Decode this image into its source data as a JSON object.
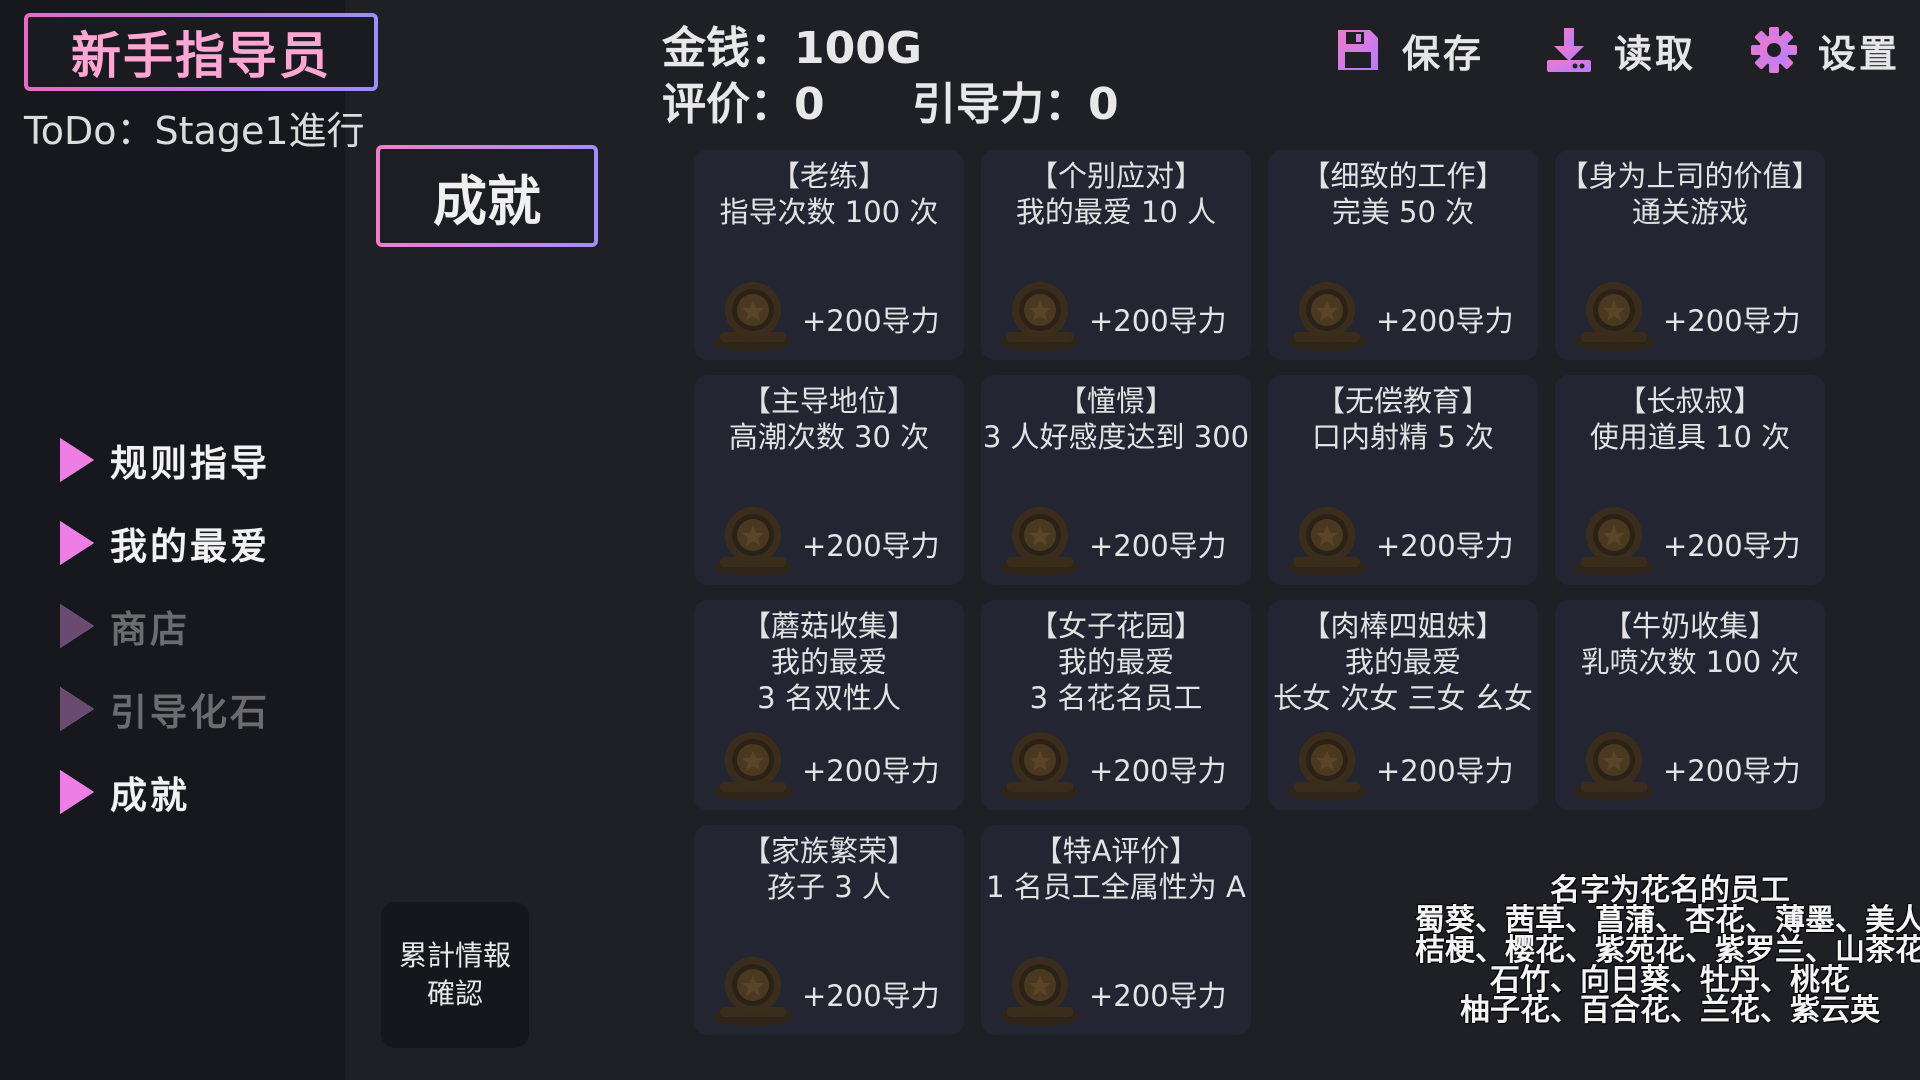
{
  "game_title": "新手指导员",
  "todo": "ToDo：Stage1進行",
  "header": {
    "money": "金钱：100G",
    "rating": "评价：0",
    "guide_power": "引导力：0"
  },
  "toolbar": {
    "save": "保存",
    "load": "读取",
    "settings": "设置"
  },
  "nav": [
    {
      "label": "规则指导",
      "enabled": true
    },
    {
      "label": "我的最爱",
      "enabled": true
    },
    {
      "label": "商店",
      "enabled": false
    },
    {
      "label": "引导化石",
      "enabled": false
    },
    {
      "label": "成就",
      "enabled": true
    }
  ],
  "page_title": "成就",
  "stats_button": {
    "line1": "累計情報",
    "line2": "確認"
  },
  "achievements": [
    {
      "name": "【老练】",
      "lines": [
        "指导次数 100 次"
      ],
      "reward": "+200导力"
    },
    {
      "name": "【个别应对】",
      "lines": [
        "我的最爱 10 人"
      ],
      "reward": "+200导力"
    },
    {
      "name": "【细致的工作】",
      "lines": [
        "完美 50 次"
      ],
      "reward": "+200导力"
    },
    {
      "name": "【身为上司的价值】",
      "lines": [
        "通关游戏"
      ],
      "reward": "+200导力"
    },
    {
      "name": "【主导地位】",
      "lines": [
        "高潮次数 30 次"
      ],
      "reward": "+200导力"
    },
    {
      "name": "【憧憬】",
      "lines": [
        "3 人好感度达到 300"
      ],
      "reward": "+200导力"
    },
    {
      "name": "【无偿教育】",
      "lines": [
        "口内射精 5 次"
      ],
      "reward": "+200导力"
    },
    {
      "name": "【长叔叔】",
      "lines": [
        "使用道具 10 次"
      ],
      "reward": "+200导力"
    },
    {
      "name": "【蘑菇收集】",
      "lines": [
        "我的最爱",
        "3 名双性人"
      ],
      "reward": "+200导力"
    },
    {
      "name": "【女子花园】",
      "lines": [
        "我的最爱",
        "3 名花名员工"
      ],
      "reward": "+200导力"
    },
    {
      "name": "【肉棒四姐妹】",
      "lines": [
        "我的最爱",
        "长女 次女 三女 幺女"
      ],
      "reward": "+200导力"
    },
    {
      "name": "【牛奶收集】",
      "lines": [
        "乳喷次数 100 次"
      ],
      "reward": "+200导力"
    },
    {
      "name": "【家族繁荣】",
      "lines": [
        "孩子 3 人"
      ],
      "reward": "+200导力"
    },
    {
      "name": "【特A评价】",
      "lines": [
        "1 名员工全属性为 A"
      ],
      "reward": "+200导力"
    }
  ],
  "note": {
    "title": "名字为花名的员工",
    "lines": [
      "蜀葵、茜草、菖蒲、杏花、薄墨、美人",
      "桔梗、樱花、紫苑花、紫罗兰、山茶花",
      "石竹、向日葵、牡丹、桃花",
      "柚子花、百合花、兰花、紫云英"
    ]
  },
  "colors": {
    "background": "#1f2026",
    "sidebar": "#17181d",
    "card": "#232533",
    "accent_pink": "#ee7ee6",
    "accent_purple": "#a48cff",
    "disabled": "#6c6c70"
  }
}
